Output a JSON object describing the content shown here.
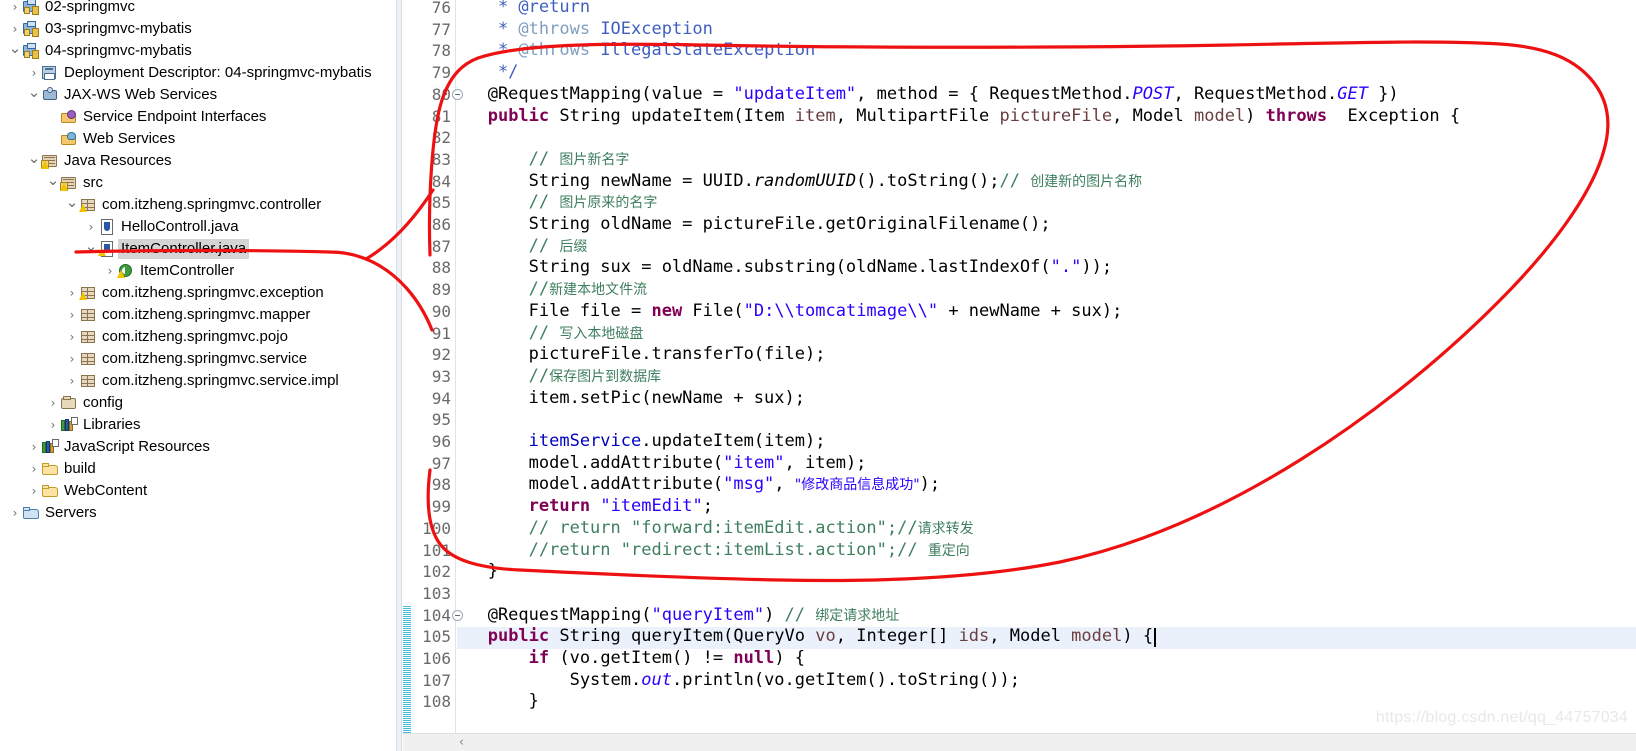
{
  "explorer": {
    "name": "Package Explorer",
    "items": [
      {
        "label": "02-springmvc",
        "indent": 0,
        "twisty": "collapsed",
        "icon": "project-icon",
        "cut_top": true,
        "selected": false
      },
      {
        "label": "03-springmvc-mybatis",
        "indent": 0,
        "twisty": "collapsed",
        "icon": "project-icon",
        "selected": false
      },
      {
        "label": "04-springmvc-mybatis",
        "indent": 0,
        "twisty": "expanded",
        "icon": "project-icon",
        "selected": false
      },
      {
        "label": "Deployment Descriptor: 04-springmvc-mybatis",
        "indent": 1,
        "twisty": "collapsed",
        "icon": "deployment-descriptor-icon",
        "selected": false
      },
      {
        "label": "JAX-WS Web Services",
        "indent": 1,
        "twisty": "expanded",
        "icon": "web-service-icon",
        "selected": false
      },
      {
        "label": "Service Endpoint Interfaces",
        "indent": 2,
        "twisty": "none",
        "icon": "service-endpoint-icon",
        "selected": false
      },
      {
        "label": "Web Services",
        "indent": 2,
        "twisty": "none",
        "icon": "web-services-folder-icon",
        "selected": false
      },
      {
        "label": "Java Resources",
        "indent": 1,
        "twisty": "expanded",
        "icon": "java-resources-icon",
        "selected": false
      },
      {
        "label": "src",
        "indent": 2,
        "twisty": "expanded",
        "icon": "source-folder-icon",
        "selected": false
      },
      {
        "label": "com.itzheng.springmvc.controller",
        "indent": 3,
        "twisty": "expanded",
        "icon": "package-warning-icon",
        "selected": false
      },
      {
        "label": "HelloControll.java",
        "indent": 4,
        "twisty": "collapsed",
        "icon": "java-file-icon",
        "selected": false
      },
      {
        "label": "ItemController.java",
        "indent": 4,
        "twisty": "expanded",
        "icon": "java-file-warning-icon",
        "selected": true
      },
      {
        "label": "ItemController",
        "indent": 5,
        "twisty": "collapsed",
        "icon": "java-class-warning-icon",
        "selected": false
      },
      {
        "label": "com.itzheng.springmvc.exception",
        "indent": 3,
        "twisty": "collapsed",
        "icon": "package-warning-icon",
        "selected": false
      },
      {
        "label": "com.itzheng.springmvc.mapper",
        "indent": 3,
        "twisty": "collapsed",
        "icon": "package-icon",
        "selected": false
      },
      {
        "label": "com.itzheng.springmvc.pojo",
        "indent": 3,
        "twisty": "collapsed",
        "icon": "package-icon",
        "selected": false
      },
      {
        "label": "com.itzheng.springmvc.service",
        "indent": 3,
        "twisty": "collapsed",
        "icon": "package-icon",
        "selected": false
      },
      {
        "label": "com.itzheng.springmvc.service.impl",
        "indent": 3,
        "twisty": "collapsed",
        "icon": "package-icon",
        "selected": false
      },
      {
        "label": "config",
        "indent": 2,
        "twisty": "collapsed",
        "icon": "config-folder-icon",
        "selected": false
      },
      {
        "label": "Libraries",
        "indent": 2,
        "twisty": "collapsed",
        "icon": "libraries-icon",
        "selected": false
      },
      {
        "label": "JavaScript Resources",
        "indent": 1,
        "twisty": "collapsed",
        "icon": "libraries-icon",
        "selected": false
      },
      {
        "label": "build",
        "indent": 1,
        "twisty": "collapsed",
        "icon": "folder-icon",
        "selected": false
      },
      {
        "label": "WebContent",
        "indent": 1,
        "twisty": "collapsed",
        "icon": "folder-icon",
        "selected": false
      },
      {
        "label": "Servers",
        "indent": 0,
        "twisty": "collapsed",
        "icon": "folder-blue-icon",
        "selected": false
      }
    ]
  },
  "editor": {
    "first_line_number": 76,
    "highlighted_line": 105,
    "folding_markers": [
      80,
      104
    ],
    "change_bar_lines": [
      104,
      105,
      106,
      107,
      108
    ],
    "caret_line": 105,
    "lines": [
      {
        "n": 76,
        "tokens": [
          {
            "t": "    * @return",
            "c": "jdoc"
          }
        ]
      },
      {
        "n": 77,
        "tokens": [
          {
            "t": "    * ",
            "c": "jdoc"
          },
          {
            "t": "@throws",
            "c": "jdoctag"
          },
          {
            "t": " IOException",
            "c": "jdoc"
          }
        ]
      },
      {
        "n": 78,
        "tokens": [
          {
            "t": "    * ",
            "c": "jdoc"
          },
          {
            "t": "@throws",
            "c": "jdoctag"
          },
          {
            "t": " IllegalStateException",
            "c": "jdoc"
          }
        ]
      },
      {
        "n": 79,
        "tokens": [
          {
            "t": "    */",
            "c": "jdoc"
          }
        ]
      },
      {
        "n": 80,
        "tokens": [
          {
            "t": "   @RequestMapping(value = ",
            "c": "plain"
          },
          {
            "t": "\"updateItem\"",
            "c": "str"
          },
          {
            "t": ", method = { RequestMethod.",
            "c": "plain"
          },
          {
            "t": "POST",
            "c": "kwblue"
          },
          {
            "t": ", RequestMethod.",
            "c": "plain"
          },
          {
            "t": "GET",
            "c": "kwblue"
          },
          {
            "t": " })",
            "c": "plain"
          }
        ]
      },
      {
        "n": 81,
        "tokens": [
          {
            "t": "   ",
            "c": "plain"
          },
          {
            "t": "public",
            "c": "kw"
          },
          {
            "t": " String updateItem(Item ",
            "c": "plain"
          },
          {
            "t": "item",
            "c": "param"
          },
          {
            "t": ", MultipartFile ",
            "c": "plain"
          },
          {
            "t": "pictureFile",
            "c": "param"
          },
          {
            "t": ", Model ",
            "c": "plain"
          },
          {
            "t": "model",
            "c": "param"
          },
          {
            "t": ") ",
            "c": "plain"
          },
          {
            "t": "throws",
            "c": "kw"
          },
          {
            "t": "  Exception {",
            "c": "plain"
          }
        ]
      },
      {
        "n": 82,
        "tokens": [
          {
            "t": "",
            "c": "plain"
          }
        ]
      },
      {
        "n": 83,
        "tokens": [
          {
            "t": "       // ",
            "c": "cmt"
          },
          {
            "t": "图片新名字",
            "c": "cmt cjk"
          }
        ]
      },
      {
        "n": 84,
        "tokens": [
          {
            "t": "       String newName = UUID.",
            "c": "plain"
          },
          {
            "t": "randomUUID",
            "c": "stat"
          },
          {
            "t": "().toString();",
            "c": "plain"
          },
          {
            "t": "// ",
            "c": "cmt"
          },
          {
            "t": "创建新的图片名称",
            "c": "cmt cjk"
          }
        ]
      },
      {
        "n": 85,
        "tokens": [
          {
            "t": "       // ",
            "c": "cmt"
          },
          {
            "t": "图片原来的名字",
            "c": "cmt cjk"
          }
        ]
      },
      {
        "n": 86,
        "tokens": [
          {
            "t": "       String oldName = pictureFile.getOriginalFilename();",
            "c": "plain"
          }
        ]
      },
      {
        "n": 87,
        "tokens": [
          {
            "t": "       // ",
            "c": "cmt"
          },
          {
            "t": "后缀",
            "c": "cmt cjk"
          }
        ]
      },
      {
        "n": 88,
        "tokens": [
          {
            "t": "       String sux = oldName.substring(oldName.lastIndexOf(",
            "c": "plain"
          },
          {
            "t": "\".\"",
            "c": "str"
          },
          {
            "t": "));",
            "c": "plain"
          }
        ]
      },
      {
        "n": 89,
        "tokens": [
          {
            "t": "       //",
            "c": "cmt"
          },
          {
            "t": "新建本地文件流",
            "c": "cmt cjk"
          }
        ]
      },
      {
        "n": 90,
        "tokens": [
          {
            "t": "       File file = ",
            "c": "plain"
          },
          {
            "t": "new",
            "c": "kw"
          },
          {
            "t": " File(",
            "c": "plain"
          },
          {
            "t": "\"D:\\\\tomcatimage\\\\\"",
            "c": "str"
          },
          {
            "t": " + newName + sux);",
            "c": "plain"
          }
        ]
      },
      {
        "n": 91,
        "tokens": [
          {
            "t": "       // ",
            "c": "cmt"
          },
          {
            "t": "写入本地磁盘",
            "c": "cmt cjk"
          }
        ]
      },
      {
        "n": 92,
        "tokens": [
          {
            "t": "       pictureFile.transferTo(file);",
            "c": "plain"
          }
        ]
      },
      {
        "n": 93,
        "tokens": [
          {
            "t": "       //",
            "c": "cmt"
          },
          {
            "t": "保存图片到数据库",
            "c": "cmt cjk"
          }
        ]
      },
      {
        "n": 94,
        "tokens": [
          {
            "t": "       item.setPic(newName + sux);",
            "c": "plain"
          }
        ]
      },
      {
        "n": 95,
        "tokens": [
          {
            "t": "",
            "c": "plain"
          }
        ]
      },
      {
        "n": 96,
        "tokens": [
          {
            "t": "       ",
            "c": "plain"
          },
          {
            "t": "itemService",
            "c": "fld"
          },
          {
            "t": ".updateItem(item);",
            "c": "plain"
          }
        ]
      },
      {
        "n": 97,
        "tokens": [
          {
            "t": "       model.addAttribute(",
            "c": "plain"
          },
          {
            "t": "\"item\"",
            "c": "str"
          },
          {
            "t": ", item);",
            "c": "plain"
          }
        ]
      },
      {
        "n": 98,
        "tokens": [
          {
            "t": "       model.addAttribute(",
            "c": "plain"
          },
          {
            "t": "\"msg\"",
            "c": "str"
          },
          {
            "t": ", ",
            "c": "plain"
          },
          {
            "t": "\"修改商品信息成功\"",
            "c": "str cjk"
          },
          {
            "t": ");",
            "c": "plain"
          }
        ]
      },
      {
        "n": 99,
        "tokens": [
          {
            "t": "       ",
            "c": "plain"
          },
          {
            "t": "return",
            "c": "kw"
          },
          {
            "t": " ",
            "c": "plain"
          },
          {
            "t": "\"itemEdit\"",
            "c": "str"
          },
          {
            "t": ";",
            "c": "plain"
          }
        ]
      },
      {
        "n": 100,
        "tokens": [
          {
            "t": "       // return \"forward:itemEdit.action\";//",
            "c": "cmt"
          },
          {
            "t": "请求转发",
            "c": "cmt cjk"
          }
        ]
      },
      {
        "n": 101,
        "tokens": [
          {
            "t": "       //return \"redirect:itemList.action\";// ",
            "c": "cmt"
          },
          {
            "t": "重定向",
            "c": "cmt cjk"
          }
        ]
      },
      {
        "n": 102,
        "tokens": [
          {
            "t": "   }",
            "c": "plain"
          }
        ]
      },
      {
        "n": 103,
        "tokens": [
          {
            "t": "",
            "c": "plain"
          }
        ]
      },
      {
        "n": 104,
        "tokens": [
          {
            "t": "   @RequestMapping(",
            "c": "plain"
          },
          {
            "t": "\"queryItem\"",
            "c": "str"
          },
          {
            "t": ") ",
            "c": "plain"
          },
          {
            "t": "// ",
            "c": "cmt"
          },
          {
            "t": "绑定请求地址",
            "c": "cmt cjk"
          }
        ]
      },
      {
        "n": 105,
        "tokens": [
          {
            "t": "   ",
            "c": "plain"
          },
          {
            "t": "public",
            "c": "kw"
          },
          {
            "t": " String queryItem(QueryVo ",
            "c": "plain"
          },
          {
            "t": "vo",
            "c": "param"
          },
          {
            "t": ", Integer[] ",
            "c": "plain"
          },
          {
            "t": "ids",
            "c": "param"
          },
          {
            "t": ", Model ",
            "c": "plain"
          },
          {
            "t": "model",
            "c": "param"
          },
          {
            "t": ") {",
            "c": "plain"
          }
        ]
      },
      {
        "n": 106,
        "tokens": [
          {
            "t": "       ",
            "c": "plain"
          },
          {
            "t": "if",
            "c": "kw"
          },
          {
            "t": " (vo.getItem() != ",
            "c": "plain"
          },
          {
            "t": "null",
            "c": "kw"
          },
          {
            "t": ") {",
            "c": "plain"
          }
        ]
      },
      {
        "n": 107,
        "tokens": [
          {
            "t": "           System.",
            "c": "plain"
          },
          {
            "t": "out",
            "c": "kwblue"
          },
          {
            "t": ".println(vo.getItem().toString());",
            "c": "plain"
          }
        ]
      },
      {
        "n": 108,
        "tokens": [
          {
            "t": "       }",
            "c": "plain"
          }
        ]
      }
    ]
  },
  "annotation": {
    "color": "#ee1111",
    "shape": "hand-drawn-circle-with-pointer",
    "description": "red freehand loop around updateItem method with arrow pointing to ItemController.java"
  },
  "watermark": {
    "text": "https://blog.csdn.net/qq_44757034"
  },
  "scrollbar": {
    "left_arrow": "‹"
  },
  "colors": {
    "keyword": "#7f0055",
    "string": "#2a00ff",
    "comment": "#3f7f5f",
    "javadoc": "#3f5fbf",
    "javadoc_tag": "#7f9fbf",
    "field": "#0000c0",
    "parameter": "#6a3e3e",
    "static": "#2a00ff",
    "selection_highlight": "#eaf1fb",
    "tree_selection": "#d5d5d5",
    "annotation_red": "#ee1111",
    "change_bar": "#31b4d6"
  }
}
